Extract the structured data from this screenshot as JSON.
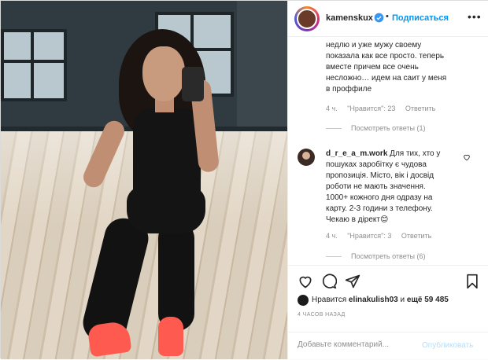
{
  "header": {
    "username": "kamenskux",
    "separator": "•",
    "follow_label": "Подписаться",
    "more_label": "•••"
  },
  "comments": [
    {
      "text_lines": [
        "недлю и уже мужу своему",
        "показала как все просто. теперь",
        "вместе причем все очень",
        "несложно… идем на саит у меня",
        "в проффиле"
      ],
      "time": "4 ч.",
      "likes": "\"Нравится\": 23",
      "reply_label": "Ответить",
      "view_replies": "Посмотреть ответы (1)"
    },
    {
      "username": "d_r_e_a_m.work",
      "text_lines": [
        "Для тих, хто у",
        "пошуках заробітку є чудова",
        "пропозиція. Місто, вік і досвід",
        "роботи не мають значення.",
        "1000+ кожного дня одразу на",
        "карту. 2-3 години з телефону.",
        "Чекаю в дірект😊"
      ],
      "time": "4 ч.",
      "likes": "\"Нравится\": 3",
      "reply_label": "Ответить",
      "view_replies": "Посмотреть ответы (6)"
    }
  ],
  "likes_line": {
    "prefix": "Нравится",
    "user": "elinakulish03",
    "middle": "и",
    "count": "ещё 59 485"
  },
  "timestamp": "4 ЧАСОВ НАЗАД",
  "add_comment": {
    "placeholder": "Добавьте комментарий...",
    "publish_label": "Опубликовать"
  },
  "icons": {
    "like": "heart-icon",
    "comment": "comment-icon",
    "share": "share-icon",
    "save": "bookmark-icon",
    "verified": "verified-badge-icon"
  },
  "colors": {
    "accent": "#0095f6",
    "publish_disabled": "#b2dffc",
    "muted": "#8e8e8e",
    "text": "#262626"
  }
}
